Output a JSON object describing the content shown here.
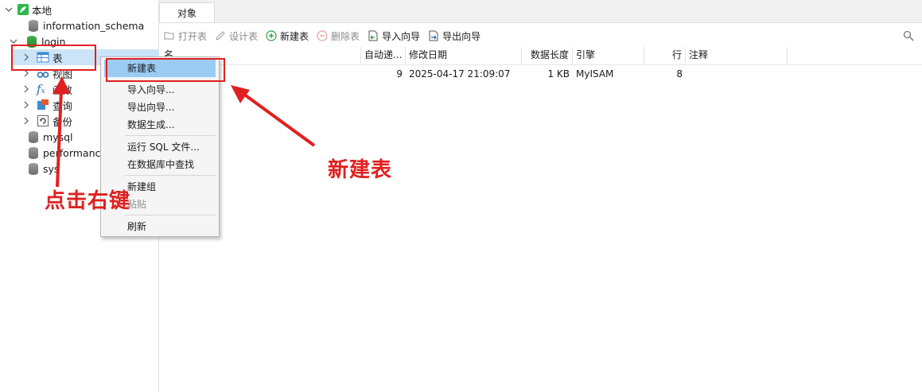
{
  "tree": {
    "root_label": "本地",
    "items": [
      {
        "label": "information_schema"
      },
      {
        "label": "login"
      },
      {
        "label": "表"
      },
      {
        "label": "视图"
      },
      {
        "label": "函数"
      },
      {
        "label": "查询"
      },
      {
        "label": "备份"
      },
      {
        "label": "mysql"
      },
      {
        "label": "performance"
      },
      {
        "label": "sys"
      }
    ]
  },
  "tabs": [
    {
      "label": "对象"
    }
  ],
  "toolbar": {
    "open_table": "打开表",
    "design_table": "设计表",
    "new_table": "新建表",
    "delete_table": "删除表",
    "import_wizard": "导入向导",
    "export_wizard": "导出向导"
  },
  "table": {
    "columns": [
      "名",
      "自动递...",
      "修改日期",
      "数据长度",
      "引擎",
      "行",
      "注释"
    ],
    "rows": [
      {
        "name": "",
        "auto_inc": "9",
        "modified": "2025-04-17 21:09:07",
        "data_length": "1 KB",
        "engine": "MyISAM",
        "rows": "8",
        "comment": ""
      }
    ]
  },
  "context_menu": {
    "items": [
      "新建表",
      "导入向导...",
      "导出向导...",
      "数据生成...",
      "运行 SQL 文件...",
      "在数据库中查找",
      "新建组",
      "粘贴",
      "刷新"
    ]
  },
  "annotations": {
    "right_click": "点击右键",
    "new_table": "新建表"
  },
  "colors": {
    "highlight": "#99cbf3",
    "annotation_red": "#e02020",
    "db_active": "#1f8a2d"
  }
}
